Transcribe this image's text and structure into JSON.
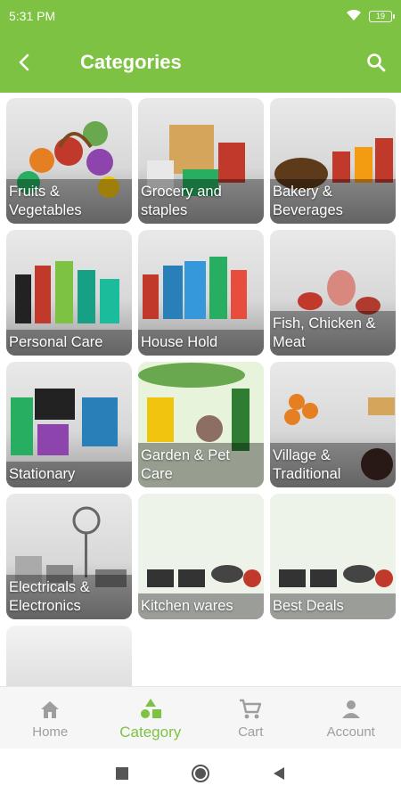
{
  "status_bar": {
    "time": "5:31 PM",
    "battery": "19"
  },
  "app_bar": {
    "title": "Categories"
  },
  "categories": [
    {
      "label": "Fruits & Vegetables"
    },
    {
      "label": "Grocery and staples"
    },
    {
      "label": "Bakery & Beverages"
    },
    {
      "label": "Personal Care"
    },
    {
      "label": "House Hold"
    },
    {
      "label": "Fish, Chicken & Meat"
    },
    {
      "label": "Stationary"
    },
    {
      "label": "Garden & Pet Care"
    },
    {
      "label": "Village & Traditional"
    },
    {
      "label": "Electricals & Electronics"
    },
    {
      "label": "Kitchen wares"
    },
    {
      "label": "Best Deals"
    }
  ],
  "bottom_nav": {
    "items": [
      {
        "label": "Home",
        "icon": "home-icon"
      },
      {
        "label": "Category",
        "icon": "category-icon",
        "active": true
      },
      {
        "label": "Cart",
        "icon": "cart-icon"
      },
      {
        "label": "Account",
        "icon": "account-icon"
      }
    ]
  },
  "colors": {
    "accent": "#7dc242",
    "inactive": "#9e9e9e"
  }
}
